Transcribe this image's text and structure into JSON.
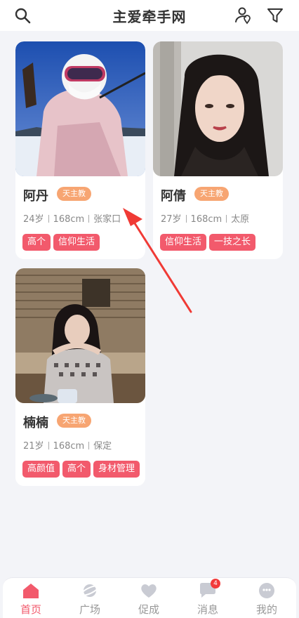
{
  "header": {
    "title": "主爱牵手网",
    "left_icon": "search-icon",
    "right_icons": [
      "person-location-icon",
      "filter-icon"
    ]
  },
  "cards": [
    {
      "name": "阿丹",
      "badge": "天主教",
      "age": "24岁",
      "height": "168cm",
      "location": "张家口",
      "tags": [
        "高个",
        "信仰生活"
      ],
      "photo_desc": "skiing-photo"
    },
    {
      "name": "阿倩",
      "badge": "天主教",
      "age": "27岁",
      "height": "168cm",
      "location": "太原",
      "tags": [
        "信仰生活",
        "一技之长"
      ],
      "photo_desc": "selfie-photo"
    },
    {
      "name": "楠楠",
      "badge": "天主教",
      "age": "21岁",
      "height": "168cm",
      "location": "保定",
      "tags": [
        "高颜值",
        "高个",
        "身材管理"
      ],
      "photo_desc": "cafe-photo"
    }
  ],
  "tabbar": {
    "items": [
      {
        "label": "首页",
        "icon": "home-icon",
        "active": true
      },
      {
        "label": "广场",
        "icon": "planet-icon",
        "active": false
      },
      {
        "label": "促成",
        "icon": "heart-icon",
        "active": false
      },
      {
        "label": "消息",
        "icon": "chat-bubble-icon",
        "active": false,
        "badge": "4"
      },
      {
        "label": "我的",
        "icon": "face-icon",
        "active": false
      }
    ]
  },
  "colors": {
    "accent": "#f25a6c",
    "badge": "#f7a572",
    "background": "#f3f4f8"
  }
}
